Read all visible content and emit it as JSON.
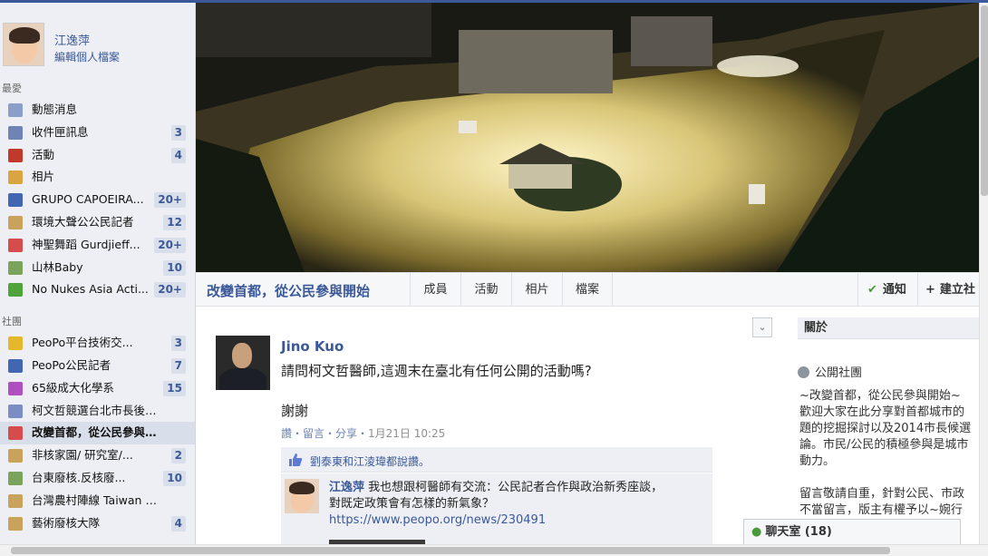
{
  "user": {
    "name": "江逸萍",
    "edit_profile": "編輯個人檔案"
  },
  "favorites": {
    "heading": "最愛",
    "items": [
      {
        "label": "動態消息",
        "count": "",
        "icon": "news-feed-icon",
        "color": "#8aa0c8"
      },
      {
        "label": "收件匣訊息",
        "count": "3",
        "icon": "messages-icon",
        "color": "#6d84b4"
      },
      {
        "label": "活動",
        "count": "4",
        "icon": "calendar-icon",
        "color": "#c0392b"
      },
      {
        "label": "相片",
        "count": "",
        "icon": "photos-icon",
        "color": "#d9a441"
      },
      {
        "label": "GRUPO CAPOEIRA...",
        "count": "20+",
        "icon": "group-icon",
        "color": "#4267b2"
      },
      {
        "label": "環境大聲公公民記者",
        "count": "12",
        "icon": "group-icon",
        "color": "#c9a35b"
      },
      {
        "label": "神聖舞蹈 Gurdjieff...",
        "count": "20+",
        "icon": "rainbow-icon",
        "color": "#d64b4b"
      },
      {
        "label": "山林Baby",
        "count": "10",
        "icon": "mountain-icon",
        "color": "#7aa35b"
      },
      {
        "label": "No Nukes Asia Acti...",
        "count": "20+",
        "icon": "sprout-icon",
        "color": "#4ea33a"
      }
    ]
  },
  "groups": {
    "heading": "社團",
    "items": [
      {
        "label": "PeoPo平台技術交...",
        "count": "3",
        "icon": "lightbulb-icon",
        "color": "#e5b82b",
        "active": false
      },
      {
        "label": "PeoPo公民記者",
        "count": "7",
        "icon": "group-icon",
        "color": "#4267b2",
        "active": false
      },
      {
        "label": "65級成大化學系",
        "count": "15",
        "icon": "flask-icon",
        "color": "#b04fc0",
        "active": false
      },
      {
        "label": "柯文哲競選台北市長後援...",
        "count": "",
        "icon": "wave-icon",
        "color": "#7b8ec4",
        "active": false
      },
      {
        "label": "改變首都，從公民參與...",
        "count": "",
        "icon": "first-aid-icon",
        "color": "#d64b4b",
        "active": true
      },
      {
        "label": "非核家園/ 研究室/...",
        "count": "2",
        "icon": "group-icon",
        "color": "#c9a35b",
        "active": false
      },
      {
        "label": "台東廢核.反核廢...",
        "count": "10",
        "icon": "mountain-icon",
        "color": "#7aa35b",
        "active": false
      },
      {
        "label": "台灣農村陣線 Taiwan Ru...",
        "count": "",
        "icon": "group-icon",
        "color": "#c9a35b",
        "active": false
      },
      {
        "label": "藝術廢核大隊",
        "count": "4",
        "icon": "group-icon",
        "color": "#c9a35b",
        "active": false
      }
    ]
  },
  "group": {
    "title": "改變首都，從公民參與開始",
    "tabs": [
      "成員",
      "活動",
      "相片",
      "檔案"
    ],
    "notify_label": "通知",
    "create_label": "建立社"
  },
  "post": {
    "author": "Jino Kuo",
    "text": "請問柯文哲醫師,這週末在臺北有任何公開的活動嗎?",
    "text2": "謝謝",
    "actions": "讚・留言・分享・",
    "timestamp": "1月21日 10:25",
    "likes_text": "劉泰東和江淩瑋都說讚。",
    "comment": {
      "name": "江逸萍",
      "text": "我也想跟柯醫師有交流：公民記者合作與政治新秀座談，對既定政策會有怎樣的新氣象？",
      "link": "https://www.peopo.org/news/230491"
    }
  },
  "about": {
    "heading": "關於",
    "privacy": "公開社團",
    "lines": [
      "~改變首都，從公民參與開始~",
      "歡迎大家在此分享對首都城市的",
      "題的挖掘探討以及2014市長候選",
      "論。市民/公民的積極參與是城市",
      "動力。",
      "",
      "留言敬請自重，針對公民、市政",
      "不當留言，版主有權予以~婉行"
    ]
  },
  "chat": {
    "label": "聊天室 (18)"
  }
}
